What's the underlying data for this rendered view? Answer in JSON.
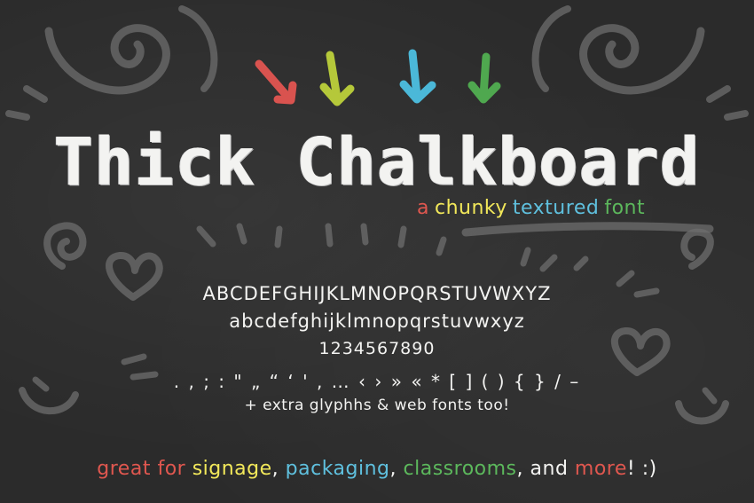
{
  "title": "Thick Chalkboard",
  "subtitle": {
    "words": [
      {
        "text": "a",
        "color": "#e0574f"
      },
      {
        "text": "chunky",
        "color": "#f2e85a"
      },
      {
        "text": "textured",
        "color": "#5fc0de"
      },
      {
        "text": "font",
        "color": "#5cb85c"
      }
    ]
  },
  "specimen": {
    "uppercase": "ABCDEFGHIJKLMNOPQRSTUVWXYZ",
    "lowercase": "abcdefghijklmnopqrstuvwxyz",
    "digits": "1234567890",
    "punctuation": ". , ; : \" „ “ ‘ ' , … ‹ › » « * [ ] ( ) { } / –",
    "extra": "+ extra glyphhs & web fonts too!"
  },
  "tagline": {
    "parts": [
      {
        "text": "great for ",
        "color": "#e0574f"
      },
      {
        "text": "signage",
        "color": "#f2e85a"
      },
      {
        "text": ", ",
        "color": "#f3f3f1"
      },
      {
        "text": "packaging",
        "color": "#5fc0de"
      },
      {
        "text": ", ",
        "color": "#f3f3f1"
      },
      {
        "text": "classrooms",
        "color": "#5cb85c"
      },
      {
        "text": ", and ",
        "color": "#f3f3f1"
      },
      {
        "text": "more",
        "color": "#e0574f"
      },
      {
        "text": "! :)",
        "color": "#f3f3f1"
      }
    ]
  },
  "arrow_colors": [
    "#d9534f",
    "#b5c83a",
    "#4bb8d8",
    "#4fa84f"
  ],
  "colors": {
    "background": "#2b2b2b",
    "chalk": "#f3f3f1",
    "doodle": "#6e6e6e"
  }
}
